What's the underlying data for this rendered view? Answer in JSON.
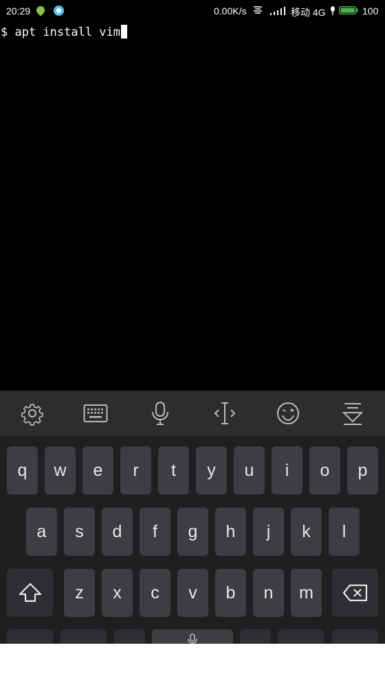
{
  "status_bar": {
    "time": "20:29",
    "net_speed": "0.00K/s",
    "carrier": "移动 4G",
    "battery": "100",
    "battery_color": "#4caf50"
  },
  "terminal": {
    "command_line": "$ apt install vim"
  },
  "keyboard": {
    "toolbar": [
      "settings-icon",
      "keyboard-icon",
      "microphone-icon",
      "cursor-icon",
      "emoji-icon",
      "hide-keyboard-icon"
    ],
    "row1": [
      "q",
      "w",
      "e",
      "r",
      "t",
      "y",
      "u",
      "i",
      "o",
      "p"
    ],
    "row2": [
      "a",
      "s",
      "d",
      "f",
      "g",
      "h",
      "j",
      "k",
      "l"
    ],
    "row3": [
      "z",
      "x",
      "c",
      "v",
      "b",
      "n",
      "m"
    ],
    "shift_icon": "shift-icon",
    "backspace_icon": "backspace-icon",
    "space_icon": "microphone-icon"
  }
}
